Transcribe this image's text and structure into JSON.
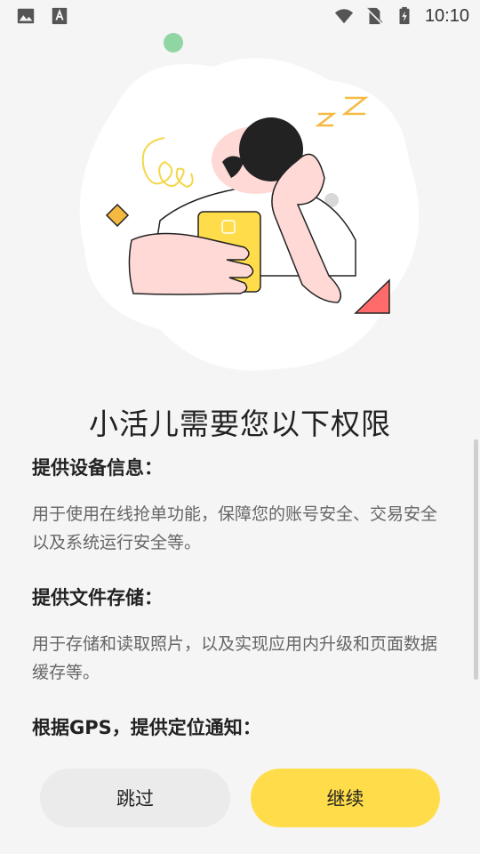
{
  "status_bar": {
    "time": "10:10",
    "icons": [
      "gallery-icon",
      "font-download-icon",
      "wifi-icon",
      "no-sim-icon",
      "battery-charging-icon"
    ]
  },
  "illustration": {
    "text": "Z Z",
    "colors": {
      "accent_yellow": "#ffdd4a",
      "skin": "#ffd9d6",
      "hair": "#222222",
      "green_dot": "#8fd6a3",
      "red_triangle": "#ff6b6b"
    }
  },
  "title": "小活儿需要您以下权限",
  "permissions": [
    {
      "title": "提供设备信息：",
      "description": "用于使用在线抢单功能，保障您的账号安全、交易安全以及系统运行安全等。"
    },
    {
      "title": "提供文件存储：",
      "description": "用于存储和读取照片，以及实现应用内升级和页面数据缓存等。"
    },
    {
      "title": "根据GPS，提供定位通知：",
      "description": ""
    }
  ],
  "buttons": {
    "skip": "跳过",
    "continue": "继续"
  },
  "colors": {
    "primary": "#ffdd4a",
    "secondary": "#ebebeb",
    "background": "#f5f5f5"
  }
}
